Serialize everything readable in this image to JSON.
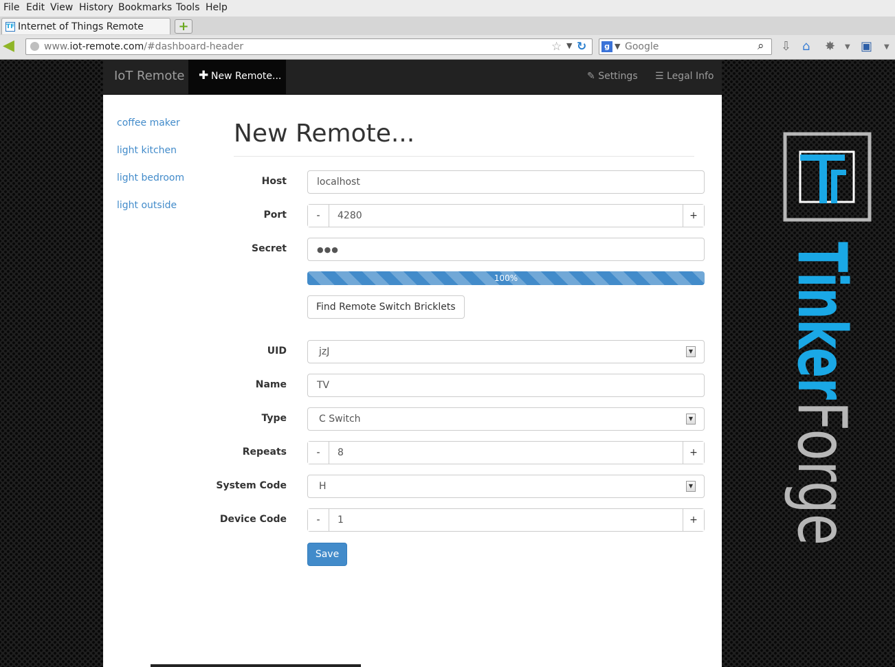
{
  "browser": {
    "menu": [
      "File",
      "Edit",
      "View",
      "History",
      "Bookmarks",
      "Tools",
      "Help"
    ],
    "tab_title": "Internet of Things Remote",
    "favicon_text": "TF",
    "url_host": "www.iot-remote.com",
    "url_path": "/#dashboard-header",
    "url_prefix": "www.",
    "url_domain": "iot-remote.com",
    "search_engine_icon": "g",
    "search_placeholder": "Google",
    "icons": [
      "back-arrow-icon",
      "globe-icon",
      "star-icon",
      "reload-icon",
      "search-icon",
      "download-icon",
      "home-icon",
      "bug-icon",
      "addon-icon"
    ]
  },
  "nav": {
    "brand": "IoT Remote",
    "new_remote": "New Remote...",
    "settings": "Settings",
    "legal": "Legal Info"
  },
  "sidebar": {
    "items": [
      "coffee maker",
      "light kitchen",
      "light bedroom",
      "light outside"
    ]
  },
  "form": {
    "title": "New Remote...",
    "host_label": "Host",
    "host_value": "localhost",
    "port_label": "Port",
    "port_value": "4280",
    "secret_label": "Secret",
    "secret_value": "●●●",
    "progress_label": "100%",
    "progress_percent": 100,
    "find_button": "Find Remote Switch Bricklets",
    "uid_label": "UID",
    "uid_value": "jzJ",
    "name_label": "Name",
    "name_value": "TV",
    "type_label": "Type",
    "type_value": "C Switch",
    "repeats_label": "Repeats",
    "repeats_value": "8",
    "system_code_label": "System Code",
    "system_code_value": "H",
    "device_code_label": "Device Code",
    "device_code_value": "1",
    "minus": "-",
    "plus": "+",
    "save": "Save"
  },
  "logo": {
    "wordmark_blue": "Tinker",
    "wordmark_grey": "Forge",
    "monogram": "TF",
    "blue_color": "#1aa8e6",
    "grey_color": "#b7b7b7"
  },
  "colors": {
    "accent": "#428bca",
    "navbar": "#222222"
  }
}
